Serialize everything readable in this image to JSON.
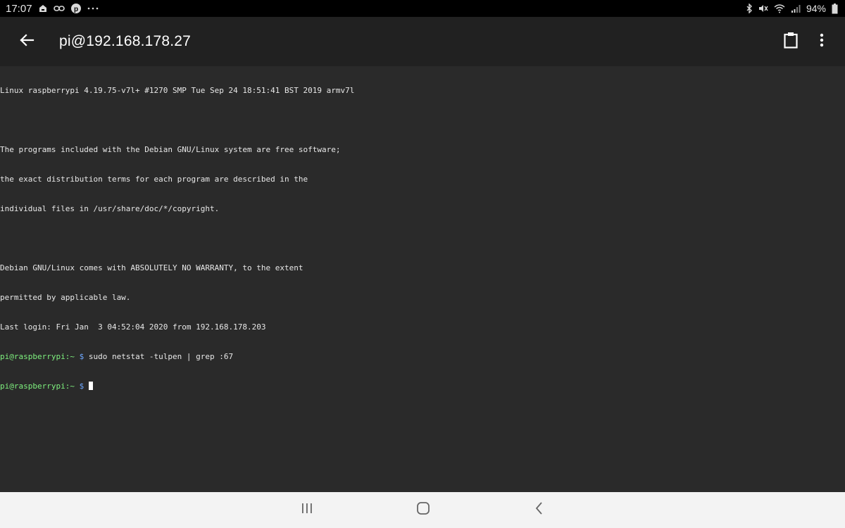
{
  "status_bar": {
    "time": "17:07",
    "left_icons": [
      "notification-icon",
      "link-icon",
      "pinterest-icon",
      "more-notifications-icon"
    ],
    "battery_percent": "94%",
    "right_icons": [
      "bluetooth-icon",
      "mute-icon",
      "wifi-icon",
      "signal-icon",
      "battery-icon"
    ]
  },
  "toolbar": {
    "title": "pi@192.168.178.27",
    "back_icon": "arrow-left-icon",
    "clipboard_icon": "clipboard-icon",
    "overflow_icon": "more-vertical-icon"
  },
  "terminal": {
    "lines": [
      "Linux raspberrypi 4.19.75-v7l+ #1270 SMP Tue Sep 24 18:51:41 BST 2019 armv7l",
      "",
      "The programs included with the Debian GNU/Linux system are free software;",
      "the exact distribution terms for each program are described in the",
      "individual files in /usr/share/doc/*/copyright.",
      "",
      "Debian GNU/Linux comes with ABSOLUTELY NO WARRANTY, to the extent",
      "permitted by applicable law.",
      "Last login: Fri Jan  3 04:52:04 2020 from 192.168.178.203"
    ],
    "prompt_user": "pi@raspberrypi",
    "prompt_path": ":~",
    "prompt_symbol": "$",
    "command": "sudo netstat -tulpen | grep :67",
    "colors": {
      "background": "#2a2a2a",
      "text": "#e8e8e8",
      "prompt": "#7ef07e",
      "dollar": "#6ea8ff"
    }
  },
  "nav_bar": {
    "icons": [
      "recent-apps-icon",
      "home-icon",
      "back-icon"
    ]
  }
}
